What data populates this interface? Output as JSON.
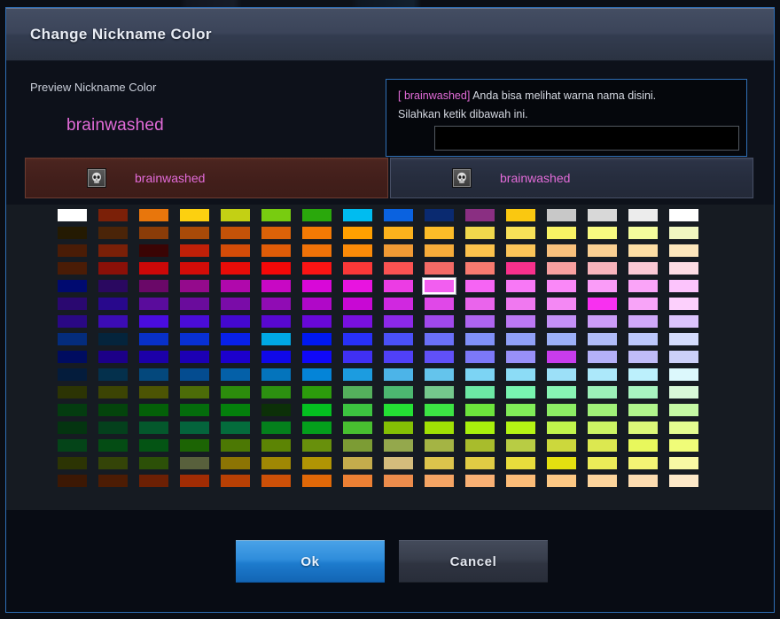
{
  "window": {
    "title": "Change Nickname Color",
    "border_color": "#2f6fb5"
  },
  "preview": {
    "label": "Preview Nickname Color",
    "nickname": "brainwashed",
    "nickname_color": "#e26bd8"
  },
  "info": {
    "nickname_tag": "[ brainwashed]",
    "line1_rest": " Anda bisa melihat warna nama disini.",
    "line2": "Silahkan ketik dibawah ini.",
    "input_value": "",
    "input_placeholder": ""
  },
  "preview_buttons": [
    {
      "name": "preview-dark-red",
      "icon": "skull-icon",
      "nickname": "brainwashed",
      "background": "#431f1b"
    },
    {
      "name": "preview-dark-blue",
      "icon": "skull-icon",
      "nickname": "brainwashed",
      "background": "#262d3e"
    }
  ],
  "palette": {
    "columns": 16,
    "rows": 16,
    "selected_index": 73,
    "selected_color": "#f25ef0",
    "colors": [
      "#ffffff",
      "#7b2008",
      "#e8760c",
      "#fcd010",
      "#c3d014",
      "#78cc10",
      "#2aa80c",
      "#00bcf0",
      "#0a62e0",
      "#0a2a70",
      "#8a2f82",
      "#fac810",
      "#c8c8c8",
      "#d8d8d8",
      "#ececec",
      "#ffffff",
      "#241a02",
      "#4a2408",
      "#8a3c08",
      "#a84a08",
      "#c45208",
      "#dc6208",
      "#f47a04",
      "#ffa000",
      "#fcb21c",
      "#fcbc28",
      "#f0d84c",
      "#f7e058",
      "#f8f264",
      "#f8fa80",
      "#f4fc9c",
      "#f0f6c0",
      "#4a1c06",
      "#7a2008",
      "#3a0404",
      "#c02008",
      "#d44c08",
      "#e05c08",
      "#f07208",
      "#fa8a08",
      "#f09a34",
      "#f6ac3a",
      "#fbc24c",
      "#fbc458",
      "#f8c07c",
      "#f9cf92",
      "#fcdda4",
      "#fce6bc",
      "#4a1c06",
      "#8a1008",
      "#cc0808",
      "#d40c08",
      "#e80c08",
      "#f40808",
      "#fc1414",
      "#fa3838",
      "#fa5252",
      "#f26a66",
      "#f87a70",
      "#f8308c",
      "#f8a0a0",
      "#f8b4bc",
      "#fac8d4",
      "#fcdce4",
      "#000a70",
      "#2a0860",
      "#6a0868",
      "#940a8c",
      "#b008ac",
      "#c808c4",
      "#d808d8",
      "#e814e0",
      "#ec3ce4",
      "#f25ef0",
      "#f664f4",
      "#f878f6",
      "#fa88f8",
      "#fa9cf8",
      "#faa4f8",
      "#fcc4fc",
      "#2a0870",
      "#28088c",
      "#5a0c9c",
      "#6a0c9c",
      "#7a0ca8",
      "#900cb4",
      "#b008c8",
      "#c808d4",
      "#d028e0",
      "#e048e8",
      "#ea64ec",
      "#f078f0",
      "#f488f4",
      "#f830f0",
      "#f8a4f8",
      "#fcd0fc",
      "#2a0884",
      "#3c0cb4",
      "#4a0ce0",
      "#4a0cd8",
      "#4408d0",
      "#5808d0",
      "#6808d8",
      "#7810e0",
      "#8c28e8",
      "#a048ec",
      "#ae64f0",
      "#bc78f4",
      "#c490f6",
      "#cc9cf8",
      "#d0a8fa",
      "#dcc4fc",
      "#042c7c",
      "#04243c",
      "#0830c8",
      "#0830d4",
      "#0820e8",
      "#00a8e4",
      "#0018f0",
      "#2830f8",
      "#4a50f8",
      "#6a70f8",
      "#8090f8",
      "#90a0f8",
      "#9cb0f8",
      "#b0bcf8",
      "#bcc8fc",
      "#d4dcfc",
      "#000c60",
      "#1c0088",
      "#1c00a8",
      "#1c00b4",
      "#1c00cc",
      "#1008e8",
      "#1008f8",
      "#4030f4",
      "#5040f8",
      "#6050f8",
      "#7c78f8",
      "#9890f8",
      "#c83cec",
      "#b4b0f8",
      "#c0bcf8",
      "#ccd0f8",
      "#041c3c",
      "#04304c",
      "#04487c",
      "#044c90",
      "#0460a8",
      "#0474bc",
      "#0484d8",
      "#1c9ce0",
      "#4cb4e8",
      "#64c4ec",
      "#7cd4f4",
      "#8cdcf6",
      "#9ce0f8",
      "#ace8fa",
      "#bcf0fc",
      "#dcf8fc",
      "#2c3404",
      "#3c4404",
      "#4c5404",
      "#4c6c08",
      "#2c8c0c",
      "#2c9010",
      "#2c9c0c",
      "#54b05c",
      "#4cb870",
      "#74c88c",
      "#6ce8a4",
      "#78f4b0",
      "#88f4b4",
      "#9cf0b8",
      "#a8f4c0",
      "#d8f8d8",
      "#043c10",
      "#04440c",
      "#046008",
      "#046c0c",
      "#04800c",
      "#0c3008",
      "#04c020",
      "#3cc440",
      "#24e034",
      "#3ce444",
      "#6ce43c",
      "#80ec58",
      "#8cec64",
      "#a0f078",
      "#b0f48c",
      "#c4f8a4",
      "#043410",
      "#04401c",
      "#04582c",
      "#04643c",
      "#046c3c",
      "#04801c",
      "#04a01c",
      "#48c030",
      "#84c004",
      "#a0e004",
      "#a8f00c",
      "#b4f414",
      "#c0f44c",
      "#ccf464",
      "#dcf878",
      "#e4fc90",
      "#044418",
      "#044c14",
      "#045414",
      "#1c6404",
      "#4c7804",
      "#5c8404",
      "#68900c",
      "#7c9c34",
      "#94a84c",
      "#a4b444",
      "#a8bc2c",
      "#b8cc44",
      "#ccd83c",
      "#dce850",
      "#e8f85c",
      "#f0fc78",
      "#2c3404",
      "#344408",
      "#2c5008",
      "#58603c",
      "#8c7404",
      "#a08804",
      "#b09404",
      "#c4ac4c",
      "#d4bc7c",
      "#dcc44c",
      "#e0cc44",
      "#e8dc3c",
      "#e4e010",
      "#ecec58",
      "#f4f474",
      "#f8f8a4",
      "#3c1804",
      "#4c1c04",
      "#6c2004",
      "#a02c04",
      "#b84004",
      "#cc5008",
      "#e06808",
      "#ec8034",
      "#ec8c4c",
      "#f4a464",
      "#f8b074",
      "#fbbc78",
      "#fcc884",
      "#fcd49c",
      "#fcdcb0",
      "#fce8c8"
    ]
  },
  "footer": {
    "ok_label": "Ok",
    "cancel_label": "Cancel"
  }
}
